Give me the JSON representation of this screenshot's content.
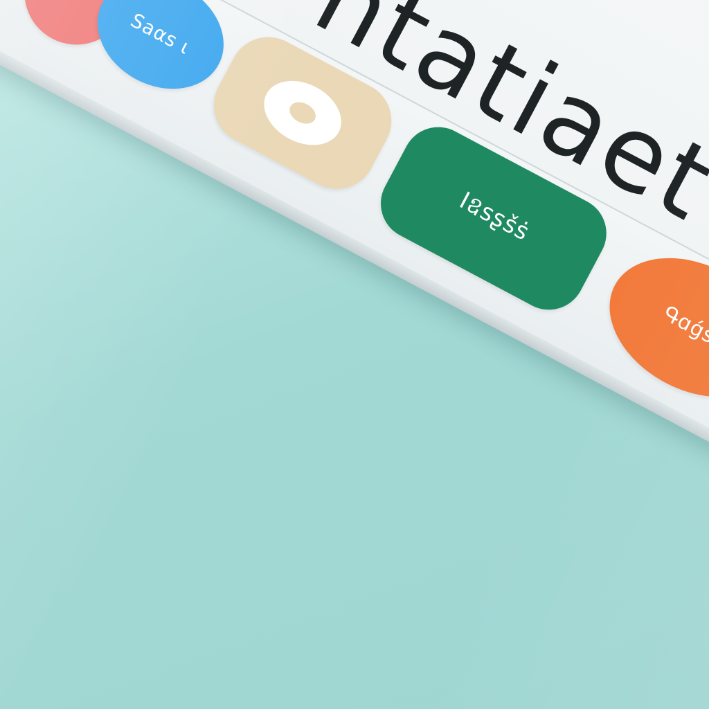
{
  "header": {
    "title": "ntatiaet"
  },
  "toolbar": {
    "buttons": [
      {
        "id": "red",
        "label": "",
        "color": "#f07a78",
        "icon": ""
      },
      {
        "id": "blue",
        "label": "Ѕaαs ɩ",
        "color": "#3fa8ef",
        "icon": ""
      },
      {
        "id": "target",
        "label": "",
        "color": "#ead8b6",
        "icon": "target-icon"
      },
      {
        "id": "green",
        "label": "Iឧsʂšṡ",
        "color": "#1f8a62",
        "icon": ""
      },
      {
        "id": "orange",
        "label": "Գɑǵśṩ",
        "color": "#f27a3b",
        "icon": ""
      }
    ]
  },
  "colors": {
    "background": "#a6dcd8",
    "screen": "#f4f7f8",
    "title_text": "#1e2326"
  }
}
